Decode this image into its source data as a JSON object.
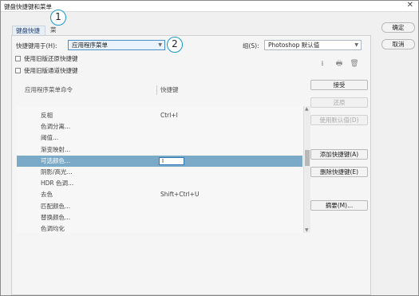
{
  "window": {
    "title": "键盘快捷键和菜单",
    "close_glyph": "✕"
  },
  "tabs": [
    {
      "label": "键盘快捷键"
    },
    {
      "label": "菜单"
    }
  ],
  "callouts": [
    "1",
    "2"
  ],
  "form": {
    "shortcuts_for_label": "快捷键用于(H):",
    "shortcuts_for_value": "应用程序菜单",
    "set_label": "组(S):",
    "set_value": "Photoshop 默认值"
  },
  "checkboxes": [
    {
      "label": "使用旧版还原快捷键",
      "checked": false
    },
    {
      "label": "使用旧版通道快捷键",
      "checked": false
    }
  ],
  "icons": {
    "save_set": "⭳",
    "new_set": "🖶",
    "delete_set": "🗑"
  },
  "table": {
    "col_command": "应用程序菜单命令",
    "col_shortcut": "快捷键",
    "rows": [
      {
        "command": "反相",
        "shortcut": "Ctrl+I"
      },
      {
        "command": "色调分离...",
        "shortcut": ""
      },
      {
        "command": "阈值...",
        "shortcut": ""
      },
      {
        "command": "渐变映射...",
        "shortcut": ""
      },
      {
        "command": "可选颜色...",
        "shortcut": "",
        "selected": true
      },
      {
        "command": "阴影/高光...",
        "shortcut": ""
      },
      {
        "command": "HDR 色调...",
        "shortcut": ""
      },
      {
        "command": "去色",
        "shortcut": "Shift+Ctrl+U"
      },
      {
        "command": "匹配颜色...",
        "shortcut": ""
      },
      {
        "command": "替换颜色...",
        "shortcut": ""
      },
      {
        "command": "色调均化",
        "shortcut": ""
      }
    ]
  },
  "side_buttons": {
    "accept": "接受",
    "undo": "还原",
    "use_default": "使用默认值(D)",
    "add_shortcut": "添加快捷键(A)",
    "delete_shortcut": "删除快捷键(E)",
    "summarize": "摘要(M)..."
  },
  "dialog_buttons": {
    "ok": "确定",
    "cancel": "取消"
  },
  "colors": {
    "accent": "#1b95c8",
    "selection": "#7aaac8"
  }
}
